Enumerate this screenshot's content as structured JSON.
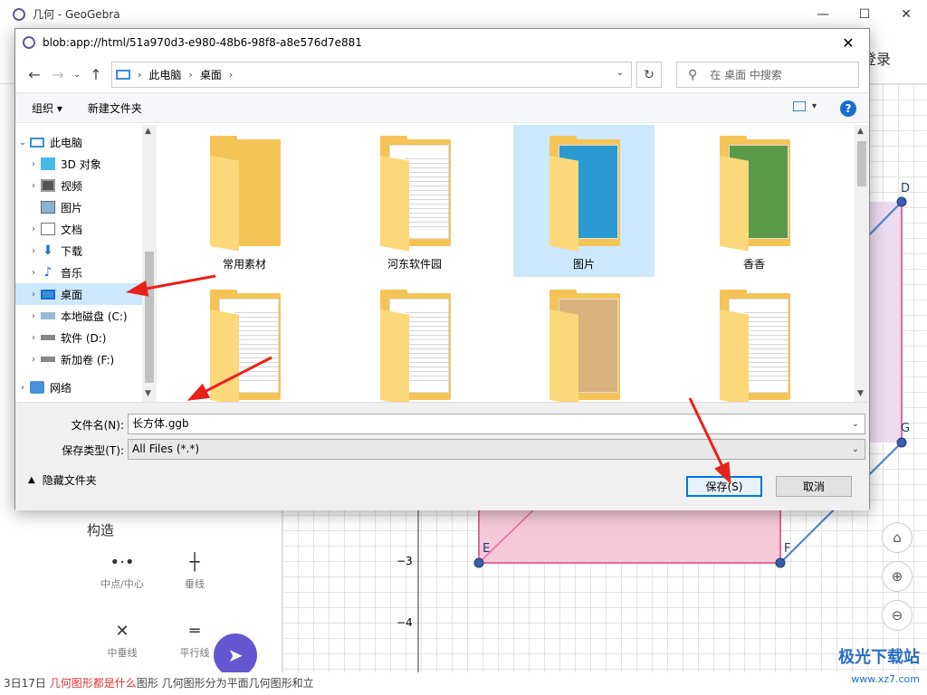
{
  "app": {
    "title": "几何 - GeoGebra",
    "login_label": "登录",
    "window_controls": {
      "minimize": "—",
      "maximize": "☐",
      "close": "✕"
    },
    "tool_section_title": "构造",
    "tools": [
      {
        "label": "中点/中心",
        "glyph": "•·•"
      },
      {
        "label": "垂线",
        "glyph": "┼"
      },
      {
        "label": "中垂线",
        "glyph": "✕"
      },
      {
        "label": "平行线",
        "glyph": "═"
      }
    ],
    "axis_labels": [
      "−3",
      "−4"
    ],
    "points": [
      "D",
      "G",
      "E",
      "F"
    ],
    "bottom_text_prefix": "3日17日 ",
    "bottom_text_red": "几何图形都是什么",
    "bottom_text_suffix": "图形 几何图形分为平面几何图形和立",
    "watermark": "极光下载站",
    "watermark_url": "www.xz7.com"
  },
  "dialog": {
    "title": "blob:app://html/51a970d3-e980-48b6-98f8-a8e576d7e881",
    "close_glyph": "✕",
    "breadcrumb": [
      "此电脑",
      "桌面"
    ],
    "search_placeholder": "在 桌面 中搜索",
    "commands": {
      "organize": "组织 ▾",
      "new_folder": "新建文件夹"
    },
    "help_label": "?",
    "tree": [
      {
        "label": "此电脑",
        "expanded": true,
        "indent": 0
      },
      {
        "label": "3D 对象",
        "indent": 1
      },
      {
        "label": "视频",
        "indent": 1
      },
      {
        "label": "图片",
        "indent": 1
      },
      {
        "label": "文档",
        "indent": 1
      },
      {
        "label": "下载",
        "indent": 1
      },
      {
        "label": "音乐",
        "indent": 1
      },
      {
        "label": "桌面",
        "indent": 1,
        "selected": true
      },
      {
        "label": "本地磁盘 (C:)",
        "indent": 1
      },
      {
        "label": "软件 (D:)",
        "indent": 1
      },
      {
        "label": "新加卷 (F:)",
        "indent": 1
      },
      {
        "label": "网络",
        "indent": 0
      }
    ],
    "files": [
      {
        "label": "常用素材"
      },
      {
        "label": "河东软件园"
      },
      {
        "label": "图片",
        "selected": true
      },
      {
        "label": "香香"
      },
      {
        "label": ""
      },
      {
        "label": ""
      },
      {
        "label": ""
      },
      {
        "label": ""
      }
    ],
    "filename_label": "文件名(N):",
    "filename_value": "长方体.ggb",
    "filetype_label": "保存类型(T):",
    "filetype_value": "All Files (*.*)",
    "hide_folders_label": "隐藏文件夹",
    "save_label": "保存(S)",
    "cancel_label": "取消"
  },
  "colors": {
    "accent": "#0078d7",
    "selection": "#cce8ff",
    "arrow_red": "#e8221b",
    "fab": "#6557d2",
    "shape_pink": "#e06b9a"
  }
}
